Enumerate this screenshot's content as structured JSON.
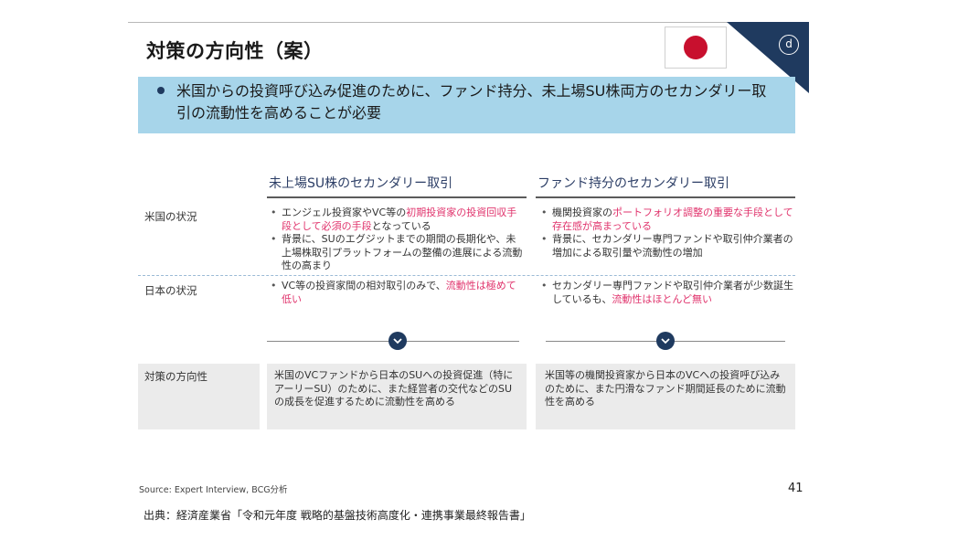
{
  "slide": {
    "title": "対策の方向性（案）",
    "corner_label": "d",
    "banner_text": "米国からの投資呼び込み促進のために、ファンド持分、未上場SU株両方のセカンダリー取引の流動性を高めることが必要",
    "columns": [
      "未上場SU株のセカンダリー取引",
      "ファンド持分のセカンダリー取引"
    ],
    "rows": [
      {
        "label": "米国の状況",
        "col1": [
          {
            "pre": "エンジェル投資家やVC等の",
            "hl": "初期投資家の投資回収手段として必須の手段",
            "post": "となっている"
          },
          {
            "pre": "背景に、SUのエグジットまでの期間の長期化や、未上場株取引プラットフォームの整備の進展による流動性の高まり",
            "hl": "",
            "post": ""
          }
        ],
        "col2": [
          {
            "pre": "機関投資家の",
            "hl": "ポートフォリオ調整の重要な手段として存在感が高まっている",
            "post": ""
          },
          {
            "pre": "背景に、セカンダリー専門ファンドや取引仲介業者の増加による取引量や流動性の増加",
            "hl": "",
            "post": ""
          }
        ]
      },
      {
        "label": "日本の状況",
        "col1": [
          {
            "pre": "VC等の投資家間の相対取引のみで、",
            "hl": "流動性は極めて低い",
            "post": ""
          }
        ],
        "col2": [
          {
            "pre": "セカンダリー専門ファンドや取引仲介業者が少数誕生しているも、",
            "hl": "流動性はほとんど無い",
            "post": ""
          }
        ]
      }
    ],
    "direction": {
      "label": "対策の方向性",
      "col1": "米国のVCファンドから日本のSUへの投資促進（特にアーリーSU）のために、また経営者の交代などのSUの成長を促進するために流動性を高める",
      "col2": "米国等の機関投資家から日本のVCへの投資呼び込みのために、また円滑なファンド期間延長のために流動性を高める"
    },
    "source": "Source: Expert Interview, BCG分析",
    "page_number": "41"
  },
  "caption": "出典：経済産業省「令和元年度 戦略的基盤技術高度化・連携事業最終報告書」",
  "colors": {
    "banner": "#a7d5ea",
    "navy": "#1f3a5f",
    "highlight": "#e0336c",
    "flag_red": "#c8102e",
    "gray_box": "#ebebeb"
  },
  "icons": [
    "japan-flag-icon",
    "chevron-down-icon"
  ]
}
